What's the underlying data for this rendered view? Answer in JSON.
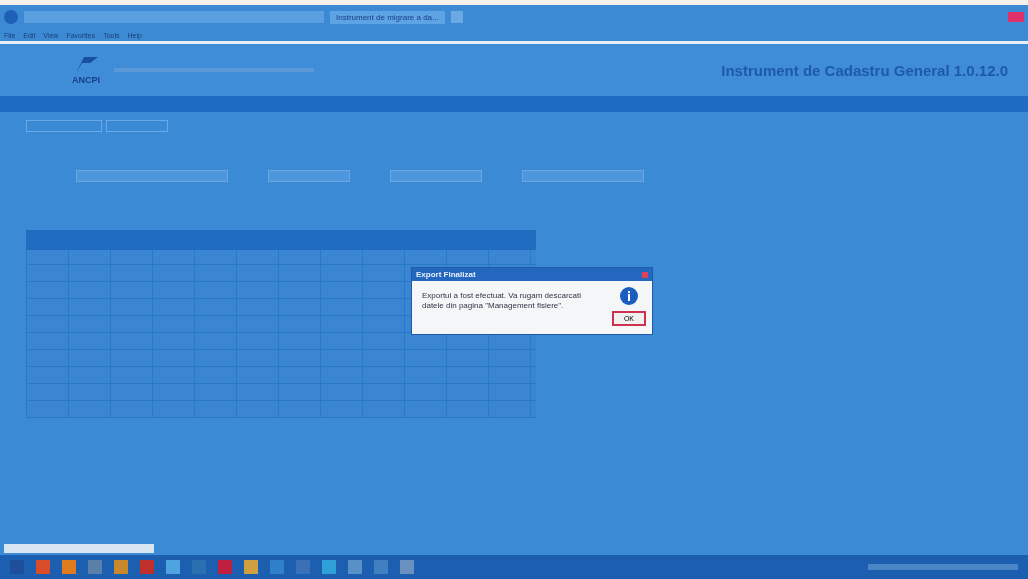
{
  "browser": {
    "tab_title": "Instrument de migrare a da...",
    "menu": [
      "File",
      "Edit",
      "View",
      "Favorites",
      "Tools",
      "Help"
    ]
  },
  "header": {
    "logo_text": "ANCPI",
    "app_title": "Instrument de Cadastru General 1.0.12.0"
  },
  "dialog": {
    "title": "Export Finalizat",
    "message": "Exportul a fost efectuat. Va rugam descarcati datele din pagina \"Management fisiere\".",
    "button": {
      "label": "OK",
      "focused": true
    }
  }
}
